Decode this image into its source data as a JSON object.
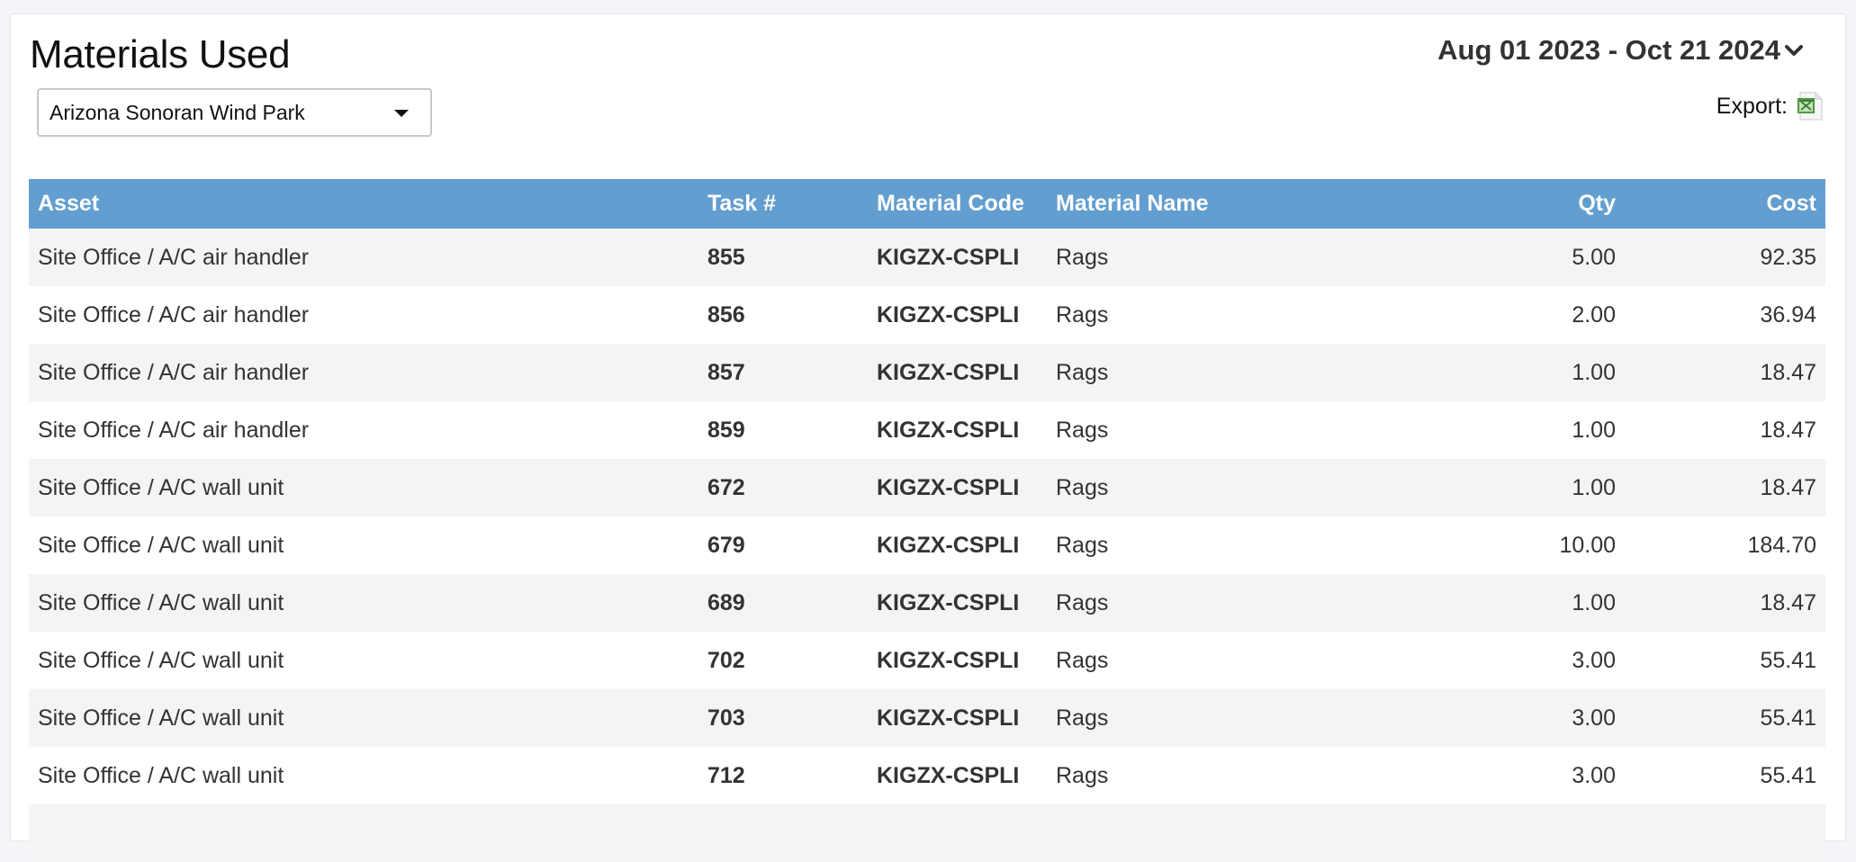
{
  "page": {
    "title": "Materials Used"
  },
  "site_select": {
    "selected": "Arizona Sonoran Wind Park"
  },
  "date_range": {
    "label": "Aug 01 2023 - Oct 21 2024"
  },
  "export": {
    "label": "Export:",
    "icon": "excel-file-icon"
  },
  "colors": {
    "header_bg": "#629ecf",
    "row_alt_bg": "#f4f4f4"
  },
  "table": {
    "columns": [
      "Asset",
      "Task #",
      "Material Code",
      "Material Name",
      "Qty",
      "Cost"
    ],
    "rows": [
      [
        "Site Office / A/C air handler",
        "855",
        "KIGZX-CSPLI",
        "Rags",
        "5.00",
        "92.35"
      ],
      [
        "Site Office / A/C air handler",
        "856",
        "KIGZX-CSPLI",
        "Rags",
        "2.00",
        "36.94"
      ],
      [
        "Site Office / A/C air handler",
        "857",
        "KIGZX-CSPLI",
        "Rags",
        "1.00",
        "18.47"
      ],
      [
        "Site Office / A/C air handler",
        "859",
        "KIGZX-CSPLI",
        "Rags",
        "1.00",
        "18.47"
      ],
      [
        "Site Office / A/C wall unit",
        "672",
        "KIGZX-CSPLI",
        "Rags",
        "1.00",
        "18.47"
      ],
      [
        "Site Office / A/C wall unit",
        "679",
        "KIGZX-CSPLI",
        "Rags",
        "10.00",
        "184.70"
      ],
      [
        "Site Office / A/C wall unit",
        "689",
        "KIGZX-CSPLI",
        "Rags",
        "1.00",
        "18.47"
      ],
      [
        "Site Office / A/C wall unit",
        "702",
        "KIGZX-CSPLI",
        "Rags",
        "3.00",
        "55.41"
      ],
      [
        "Site Office / A/C wall unit",
        "703",
        "KIGZX-CSPLI",
        "Rags",
        "3.00",
        "55.41"
      ],
      [
        "Site Office / A/C wall unit",
        "712",
        "KIGZX-CSPLI",
        "Rags",
        "3.00",
        "55.41"
      ],
      [
        "",
        "",
        "",
        "",
        "",
        ""
      ]
    ]
  }
}
